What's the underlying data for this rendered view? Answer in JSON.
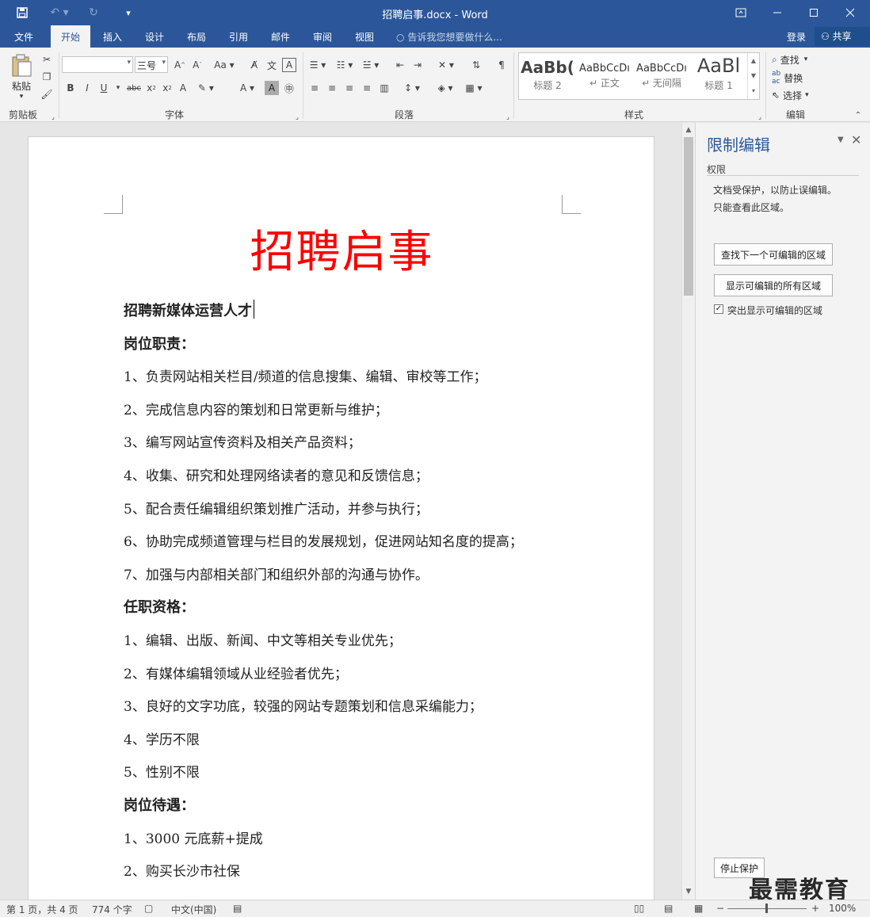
{
  "window": {
    "title": "招聘启事.docx - Word",
    "quick_access": {
      "save_icon": "save-icon",
      "undo_icon": "undo-icon",
      "redo_icon": "redo-icon",
      "customize_icon": "customize-icon"
    },
    "controls": {
      "ribbon_display": "ribbon-display-icon",
      "minimize": "minimize-icon",
      "maximize": "maximize-icon",
      "close": "close-icon"
    }
  },
  "tabs": [
    "文件",
    "开始",
    "插入",
    "设计",
    "布局",
    "引用",
    "邮件",
    "审阅",
    "视图"
  ],
  "active_tab": "开始",
  "tell_me": "告诉我您想要做什么...",
  "login": "登录",
  "share": "共享",
  "ribbon": {
    "clipboard": {
      "label": "剪贴板",
      "paste": "粘贴"
    },
    "font": {
      "label": "字体",
      "font_name": "",
      "font_size": "三号"
    },
    "paragraph": {
      "label": "段落"
    },
    "styles": {
      "label": "样式",
      "items": [
        {
          "sample": "AaBb(",
          "name": "标题 2"
        },
        {
          "sample": "AaBbCcDı",
          "name": "↵ 正文"
        },
        {
          "sample": "AaBbCcDı",
          "name": "↵ 无间隔"
        },
        {
          "sample": "AaBl",
          "name": "标题 1"
        }
      ]
    },
    "editing": {
      "label": "编辑",
      "find": "查找",
      "replace": "替换",
      "select": "选择"
    }
  },
  "document": {
    "title": "招聘启事",
    "lines": [
      {
        "text": "招聘新媒体运营人才",
        "bold": true
      },
      {
        "text": "岗位职责：",
        "bold": true
      },
      {
        "text": "1、负责网站相关栏目/频道的信息搜集、编辑、审校等工作；",
        "bold": false
      },
      {
        "text": "2、完成信息内容的策划和日常更新与维护；",
        "bold": false
      },
      {
        "text": "3、编写网站宣传资料及相关产品资料；",
        "bold": false
      },
      {
        "text": "4、收集、研究和处理网络读者的意见和反馈信息；",
        "bold": false
      },
      {
        "text": "5、配合责任编辑组织策划推广活动，并参与执行；",
        "bold": false
      },
      {
        "text": "6、协助完成频道管理与栏目的发展规划，促进网站知名度的提高；",
        "bold": false
      },
      {
        "text": "7、加强与内部相关部门和组织外部的沟通与协作。",
        "bold": false
      },
      {
        "text": "任职资格：",
        "bold": true
      },
      {
        "text": "1、编辑、出版、新闻、中文等相关专业优先；",
        "bold": false
      },
      {
        "text": "2、有媒体编辑领域从业经验者优先；",
        "bold": false
      },
      {
        "text": "3、良好的文字功底，较强的网站专题策划和信息采编能力；",
        "bold": false
      },
      {
        "text": "4、学历不限",
        "bold": false
      },
      {
        "text": "5、性别不限",
        "bold": false
      },
      {
        "text": "岗位待遇：",
        "bold": true
      },
      {
        "text": "1、3000 元底薪+提成",
        "bold": false
      },
      {
        "text": "2、购买长沙市社保",
        "bold": false
      }
    ]
  },
  "pane": {
    "title": "限制编辑",
    "section": "权限",
    "desc1": "文档受保护，以防止误编辑。",
    "desc2": "只能查看此区域。",
    "btn_find_next": "查找下一个可编辑的区域",
    "btn_show_all": "显示可编辑的所有区域",
    "checkbox_label": "突出显示可编辑的区域",
    "checkbox_checked": true,
    "btn_stop": "停止保护"
  },
  "status": {
    "page": "第 1 页，共 4 页",
    "words": "774 个字",
    "language": "中文(中国)",
    "zoom": "100%"
  },
  "watermark": "最需教育"
}
